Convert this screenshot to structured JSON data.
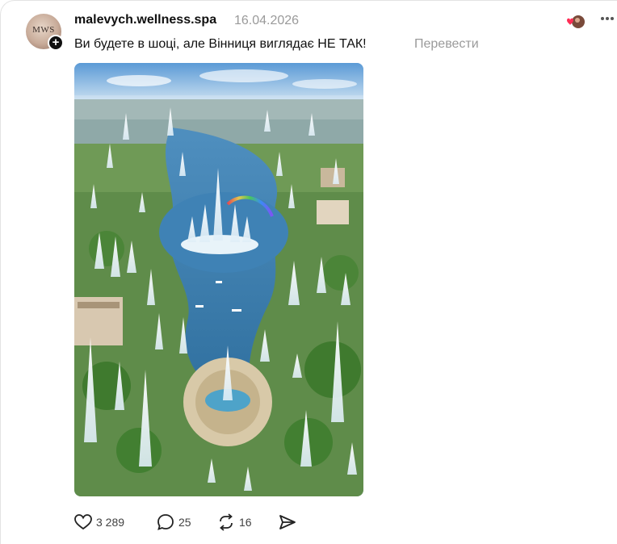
{
  "post": {
    "avatar_text": "MWS",
    "username": "malevych.wellness.spa",
    "date": "16.04.2026",
    "text": "Ви будете в шоці, але Вінниця виглядає НЕ ТАК!",
    "translate_label": "Перевести"
  },
  "image": {
    "description_icon": "fountain-city-photo"
  },
  "actions": {
    "likes": "3 289",
    "comments": "25",
    "reposts": "16"
  },
  "icons": {
    "like": "heart-icon",
    "comment": "comment-icon",
    "repost": "repost-icon",
    "share": "send-icon",
    "more": "more-icon"
  },
  "colors": {
    "text": "#101010",
    "muted": "#9a9a9a",
    "water": "#3a7fb0",
    "greenery": "#4f8a3a"
  }
}
